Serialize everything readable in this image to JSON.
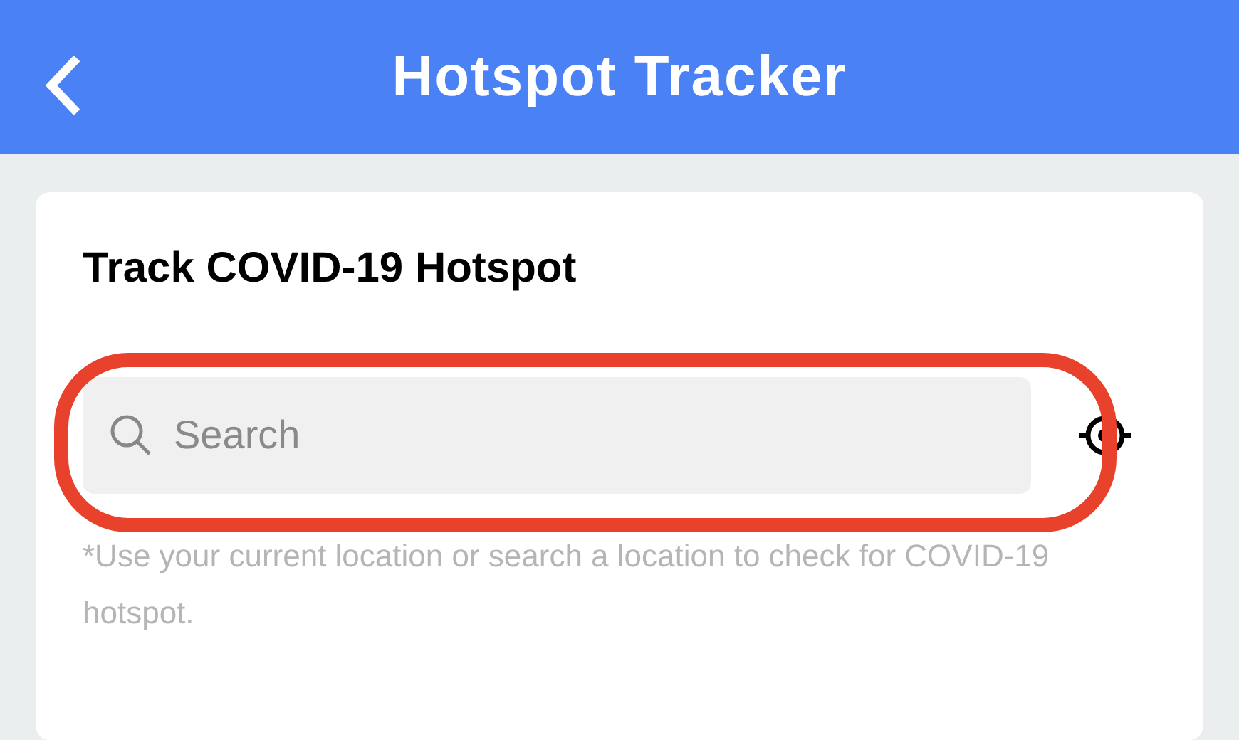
{
  "header": {
    "title": "Hotspot Tracker"
  },
  "card": {
    "title": "Track COVID-19 Hotspot",
    "search": {
      "placeholder": "Search"
    },
    "hint": "*Use your current location or search a location to check for COVID-19 hotspot.",
    "highlighted": true
  }
}
